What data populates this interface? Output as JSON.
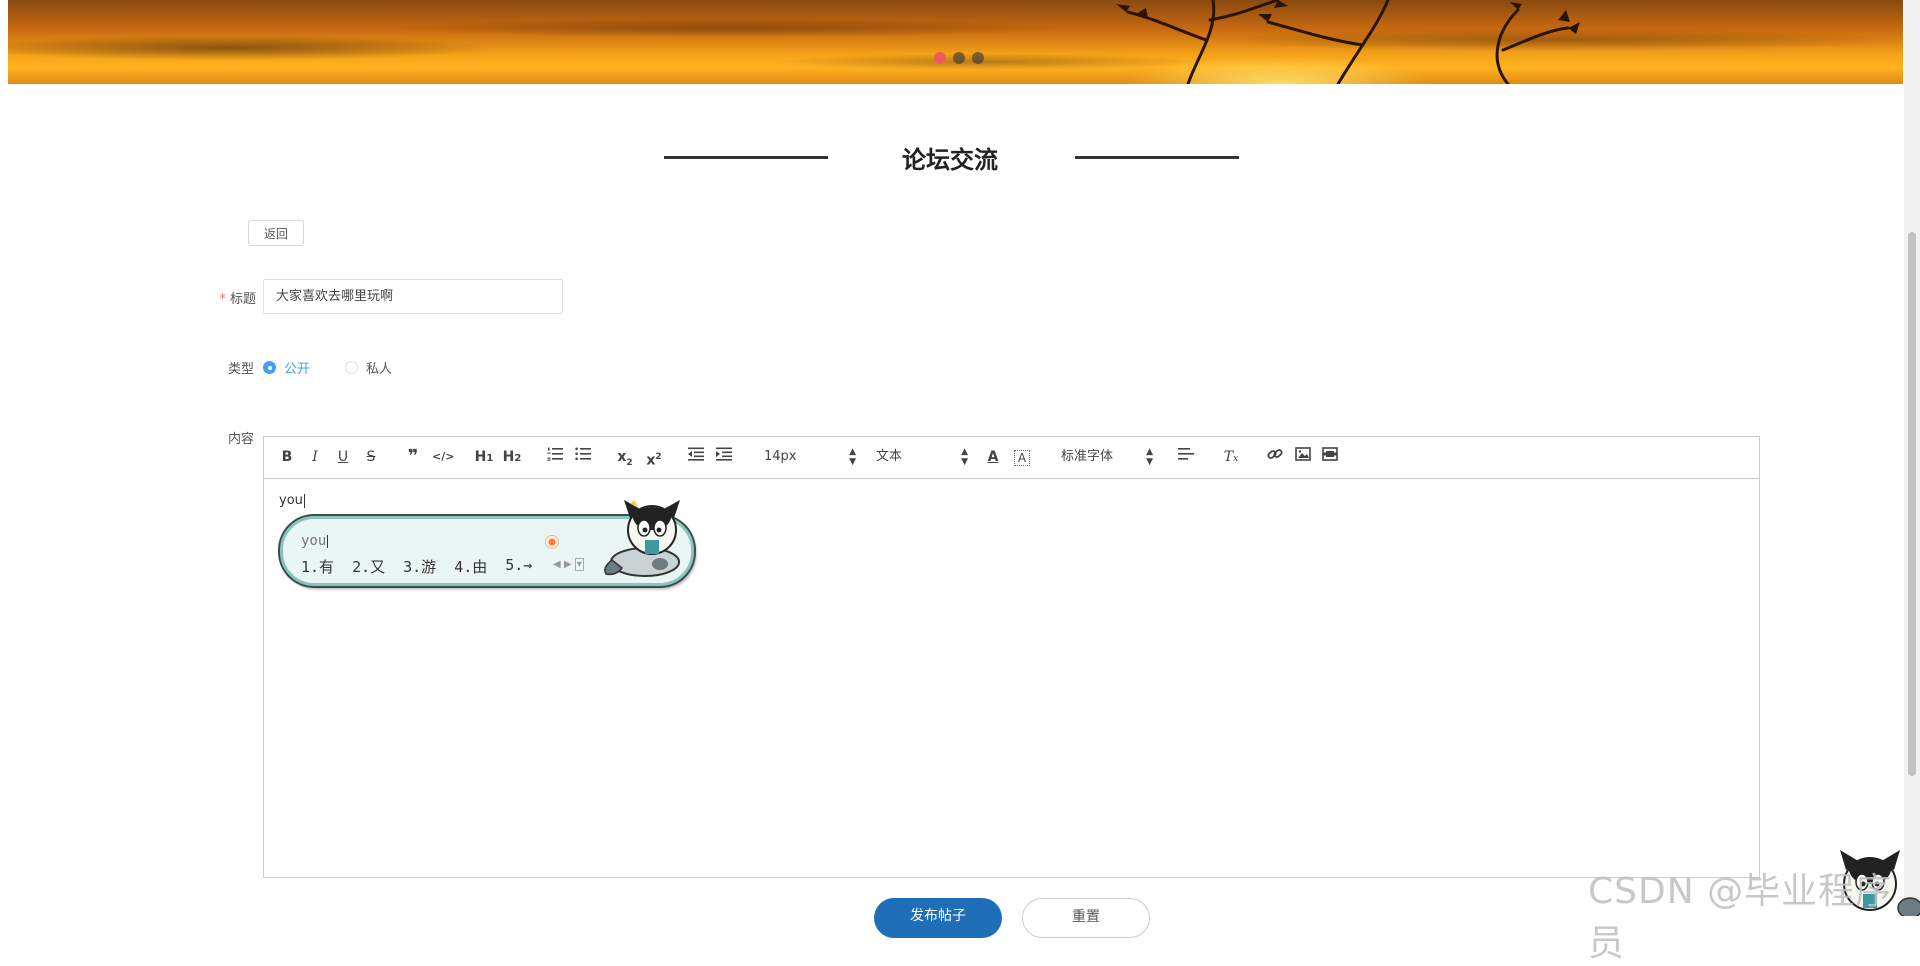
{
  "banner": {
    "carousel_dots": 3,
    "active_dot": 0
  },
  "page": {
    "title": "论坛交流",
    "back_label": "返回"
  },
  "form": {
    "title_label": "标题",
    "title_value": "大家喜欢去哪里玩啊",
    "type_label": "类型",
    "type_options": [
      "公开",
      "私人"
    ],
    "type_selected": "公开",
    "content_label": "内容"
  },
  "editor": {
    "toolbar": {
      "bold": "B",
      "italic": "I",
      "underline": "U",
      "strike": "S",
      "blockquote": "❞",
      "code": "</>",
      "h1": "H",
      "h1_sub": "1",
      "h2": "H",
      "h2_sub": "2",
      "subscript": "x",
      "subscript_mark": "2",
      "superscript": "x",
      "superscript_mark": "2",
      "size": "14px",
      "header": "文本",
      "font": "标准字体"
    },
    "content": "you"
  },
  "ime": {
    "composing": "you",
    "candidates": [
      "1.有",
      "2.又",
      "3.游",
      "4.由",
      "5.→"
    ]
  },
  "buttons": {
    "submit": "发布帖子",
    "reset": "重置"
  },
  "watermark": "CSDN @毕业程序员",
  "colors": {
    "accent": "#409eff",
    "primary_button": "#1e6fb7",
    "required": "#f56c6c"
  }
}
